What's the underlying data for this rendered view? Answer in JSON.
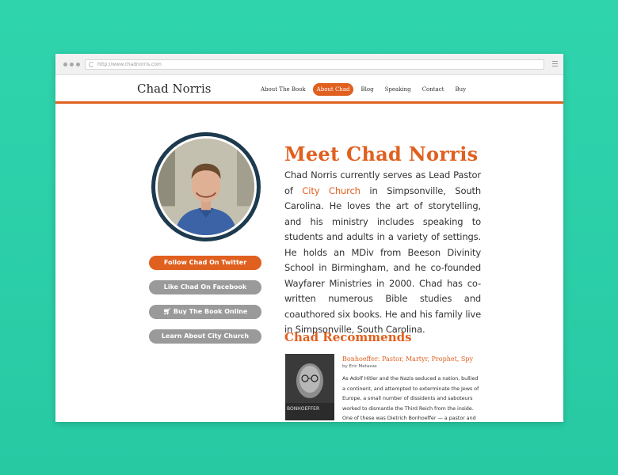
{
  "browser": {
    "url": "http://www.chadnorris.com"
  },
  "header": {
    "brand": "Chad Norris",
    "nav": [
      {
        "label": "About The Book",
        "active": false
      },
      {
        "label": "About Chad",
        "active": true
      },
      {
        "label": "Blog",
        "active": false
      },
      {
        "label": "Speaking",
        "active": false
      },
      {
        "label": "Contact",
        "active": false
      },
      {
        "label": "Buy",
        "active": false
      }
    ]
  },
  "sidebar": {
    "buttons": {
      "twitter": "Follow Chad On Twitter",
      "facebook": "Like Chad On Facebook",
      "buy": "Buy The Book Online",
      "church": "Learn About City Church"
    }
  },
  "main": {
    "title": "Meet Chad Norris",
    "bio_before": "Chad Norris currently serves as Lead Pastor of",
    "bio_link": "City Church",
    "bio_after": "in Simpsonville, South Carolina. He loves the art of storytelling, and his ministry includes speaking to students and adults in a variety of settings. He holds an MDiv from Beeson Divinity School in Birmingham, and he co-founded Wayfarer Ministries in 2000. Chad has co-written numerous Bible studies and coauthored six books. He and his family live in Simpsonville, South Carolina.",
    "recommends_heading": "Chad Recommends",
    "book": {
      "title": "Bonhoeffer: Pastor, Martyr, Prophet, Spy",
      "author": "by Eric Metaxas",
      "cover_text": "BONHOEFFER",
      "description": "As Adolf Hitler and the Nazis seduced a nation, bullied a continent, and attempted to exterminate the Jews of Europe, a small number of dissidents and saboteurs worked to dismantle the Third Reich from the inside. One of these was Dietrich Bonhoeffer — a pastor and"
    }
  },
  "colors": {
    "accent": "#e0601f",
    "background": "#2fd4ad",
    "button_gray": "#9a9a9a",
    "avatar_ring": "#1d3a4e"
  }
}
